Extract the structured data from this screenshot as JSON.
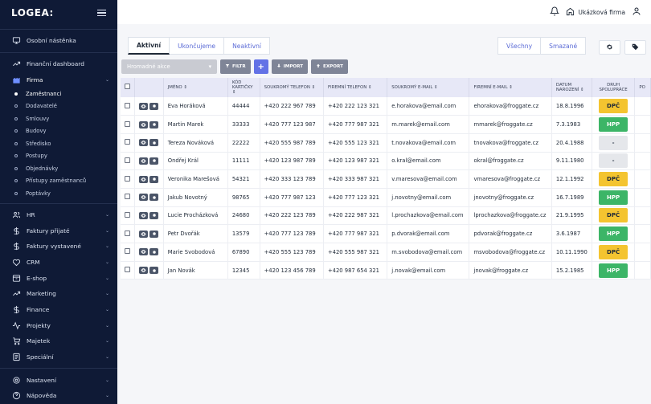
{
  "app": {
    "logo": "LOGEA:"
  },
  "sidebar": {
    "top": [
      {
        "name": "osobni-nastenka",
        "label": "Osobní nástěnka",
        "icon": "monitor-icon"
      }
    ],
    "items": [
      {
        "name": "financni-dashboard",
        "label": "Finanční dashboard",
        "icon": "trending-up-icon",
        "chev": false
      },
      {
        "name": "firma",
        "label": "Firma",
        "icon": "building-icon",
        "chev": true,
        "active": true
      }
    ],
    "firma_sub": [
      {
        "label": "Zaměstnanci",
        "active": true
      },
      {
        "label": "Dodavatelé"
      },
      {
        "label": "Smlouvy"
      },
      {
        "label": "Budovy"
      },
      {
        "label": "Středisko"
      },
      {
        "label": "Postupy"
      },
      {
        "label": "Objednávky"
      },
      {
        "label": "Přístupy zaměstnanců"
      },
      {
        "label": "Poptávky"
      }
    ],
    "items2": [
      {
        "name": "hr",
        "label": "HR",
        "icon": "users-icon"
      },
      {
        "name": "faktury-prijate",
        "label": "Faktury přijaté",
        "icon": "dollar-icon"
      },
      {
        "name": "faktury-vystavene",
        "label": "Faktury vystavené",
        "icon": "dollar-icon"
      },
      {
        "name": "crm",
        "label": "CRM",
        "icon": "heart-icon"
      },
      {
        "name": "e-shop",
        "label": "E-shop",
        "icon": "box-icon"
      },
      {
        "name": "marketing",
        "label": "Marketing",
        "icon": "trending-up-icon"
      },
      {
        "name": "finance",
        "label": "Finance",
        "icon": "dollar-icon"
      },
      {
        "name": "projekty",
        "label": "Projekty",
        "icon": "activity-icon"
      },
      {
        "name": "majetek",
        "label": "Majetek",
        "icon": "cart-icon"
      },
      {
        "name": "specialni",
        "label": "Speciální",
        "icon": "flag-icon"
      }
    ],
    "bottom": [
      {
        "name": "nastaveni",
        "label": "Nastavení",
        "icon": "gear-icon"
      },
      {
        "name": "napoveda",
        "label": "Nápověda",
        "icon": "help-icon"
      }
    ]
  },
  "topbar": {
    "company": "Ukázková firma"
  },
  "tabs": [
    "Aktivní",
    "Ukončujeme",
    "Neaktivní"
  ],
  "tabs_right": [
    "Všechny",
    "Smazané"
  ],
  "toolbar": {
    "bulk_label": "Hromadné akce",
    "filter_label": "FILTR",
    "add_label": "+",
    "import_label": "IMPORT",
    "export_label": "EXPORT"
  },
  "table": {
    "columns": [
      "JMÉNO ⇕",
      "KÓD KARTIČKY ⇕",
      "SOUKROMÝ TELEFON ⇕",
      "FIREMNÍ TELEFON ⇕",
      "SOUKROMÝ E-MAIL ⇕",
      "FIREMNÍ E-MAIL ⇕",
      "DATUM NAROZENÍ ⇕",
      "DRUH SPOLUPRÁCE",
      "PO"
    ],
    "rows": [
      {
        "name": "Eva Horáková",
        "code": "44444",
        "phone": "+420 222 967 789",
        "work_phone": "+420 222 123 321",
        "email": "e.horakova@email.com",
        "work_email": "ehorakova@froggate.cz",
        "dob": "18.8.1996",
        "type": "DPČ"
      },
      {
        "name": "Martin Marek",
        "code": "33333",
        "phone": "+420 777 123 987",
        "work_phone": "+420 777 987 321",
        "email": "m.marek@email.com",
        "work_email": "mmarek@froggate.cz",
        "dob": "7.3.1983",
        "type": "HPP"
      },
      {
        "name": "Tereza Nováková",
        "code": "22222",
        "phone": "+420 555 987 789",
        "work_phone": "+420 555 123 321",
        "email": "t.novakova@email.com",
        "work_email": "tnovakova@froggate.cz",
        "dob": "20.4.1988",
        "type": "-"
      },
      {
        "name": "Ondřej Král",
        "code": "11111",
        "phone": "+420 123 987 789",
        "work_phone": "+420 123 987 321",
        "email": "o.kral@email.com",
        "work_email": "okral@froggate.cz",
        "dob": "9.11.1980",
        "type": "-"
      },
      {
        "name": "Veronika Marešová",
        "code": "54321",
        "phone": "+420 333 123 789",
        "work_phone": "+420 333 987 321",
        "email": "v.maresova@email.com",
        "work_email": "vmaresova@froggate.cz",
        "dob": "12.1.1992",
        "type": "DPČ"
      },
      {
        "name": "Jakub Novotný",
        "code": "98765",
        "phone": "+420 777 987 123",
        "work_phone": "+420 777 123 321",
        "email": "j.novotny@email.com",
        "work_email": "jnovotny@froggate.cz",
        "dob": "16.7.1989",
        "type": "HPP"
      },
      {
        "name": "Lucie Procházková",
        "code": "24680",
        "phone": "+420 222 123 789",
        "work_phone": "+420 222 987 321",
        "email": "l.prochazkova@email.com",
        "work_email": "lprochazkova@froggate.cz",
        "dob": "21.9.1995",
        "type": "DPČ"
      },
      {
        "name": "Petr Dvořák",
        "code": "13579",
        "phone": "+420 777 123 789",
        "work_phone": "+420 777 987 321",
        "email": "p.dvorak@email.com",
        "work_email": "pdvorak@froggate.cz",
        "dob": "3.6.1987",
        "type": "HPP"
      },
      {
        "name": "Marie Svobodová",
        "code": "67890",
        "phone": "+420 555 123 789",
        "work_phone": "+420 555 987 321",
        "email": "m.svobodova@email.com",
        "work_email": "msvobodova@froggate.cz",
        "dob": "10.11.1990",
        "type": "DPČ"
      },
      {
        "name": "Jan Novák",
        "code": "12345",
        "phone": "+420 123 456 789",
        "work_phone": "+420 987 654 321",
        "email": "j.novak@email.com",
        "work_email": "jnovak@froggate.cz",
        "dob": "15.2.1985",
        "type": "HPP"
      }
    ]
  },
  "colors": {
    "sidebar_bg": "#0f1a36",
    "accent": "#6372e6",
    "dpc": "#f4c430",
    "hpp": "#3cb567"
  }
}
